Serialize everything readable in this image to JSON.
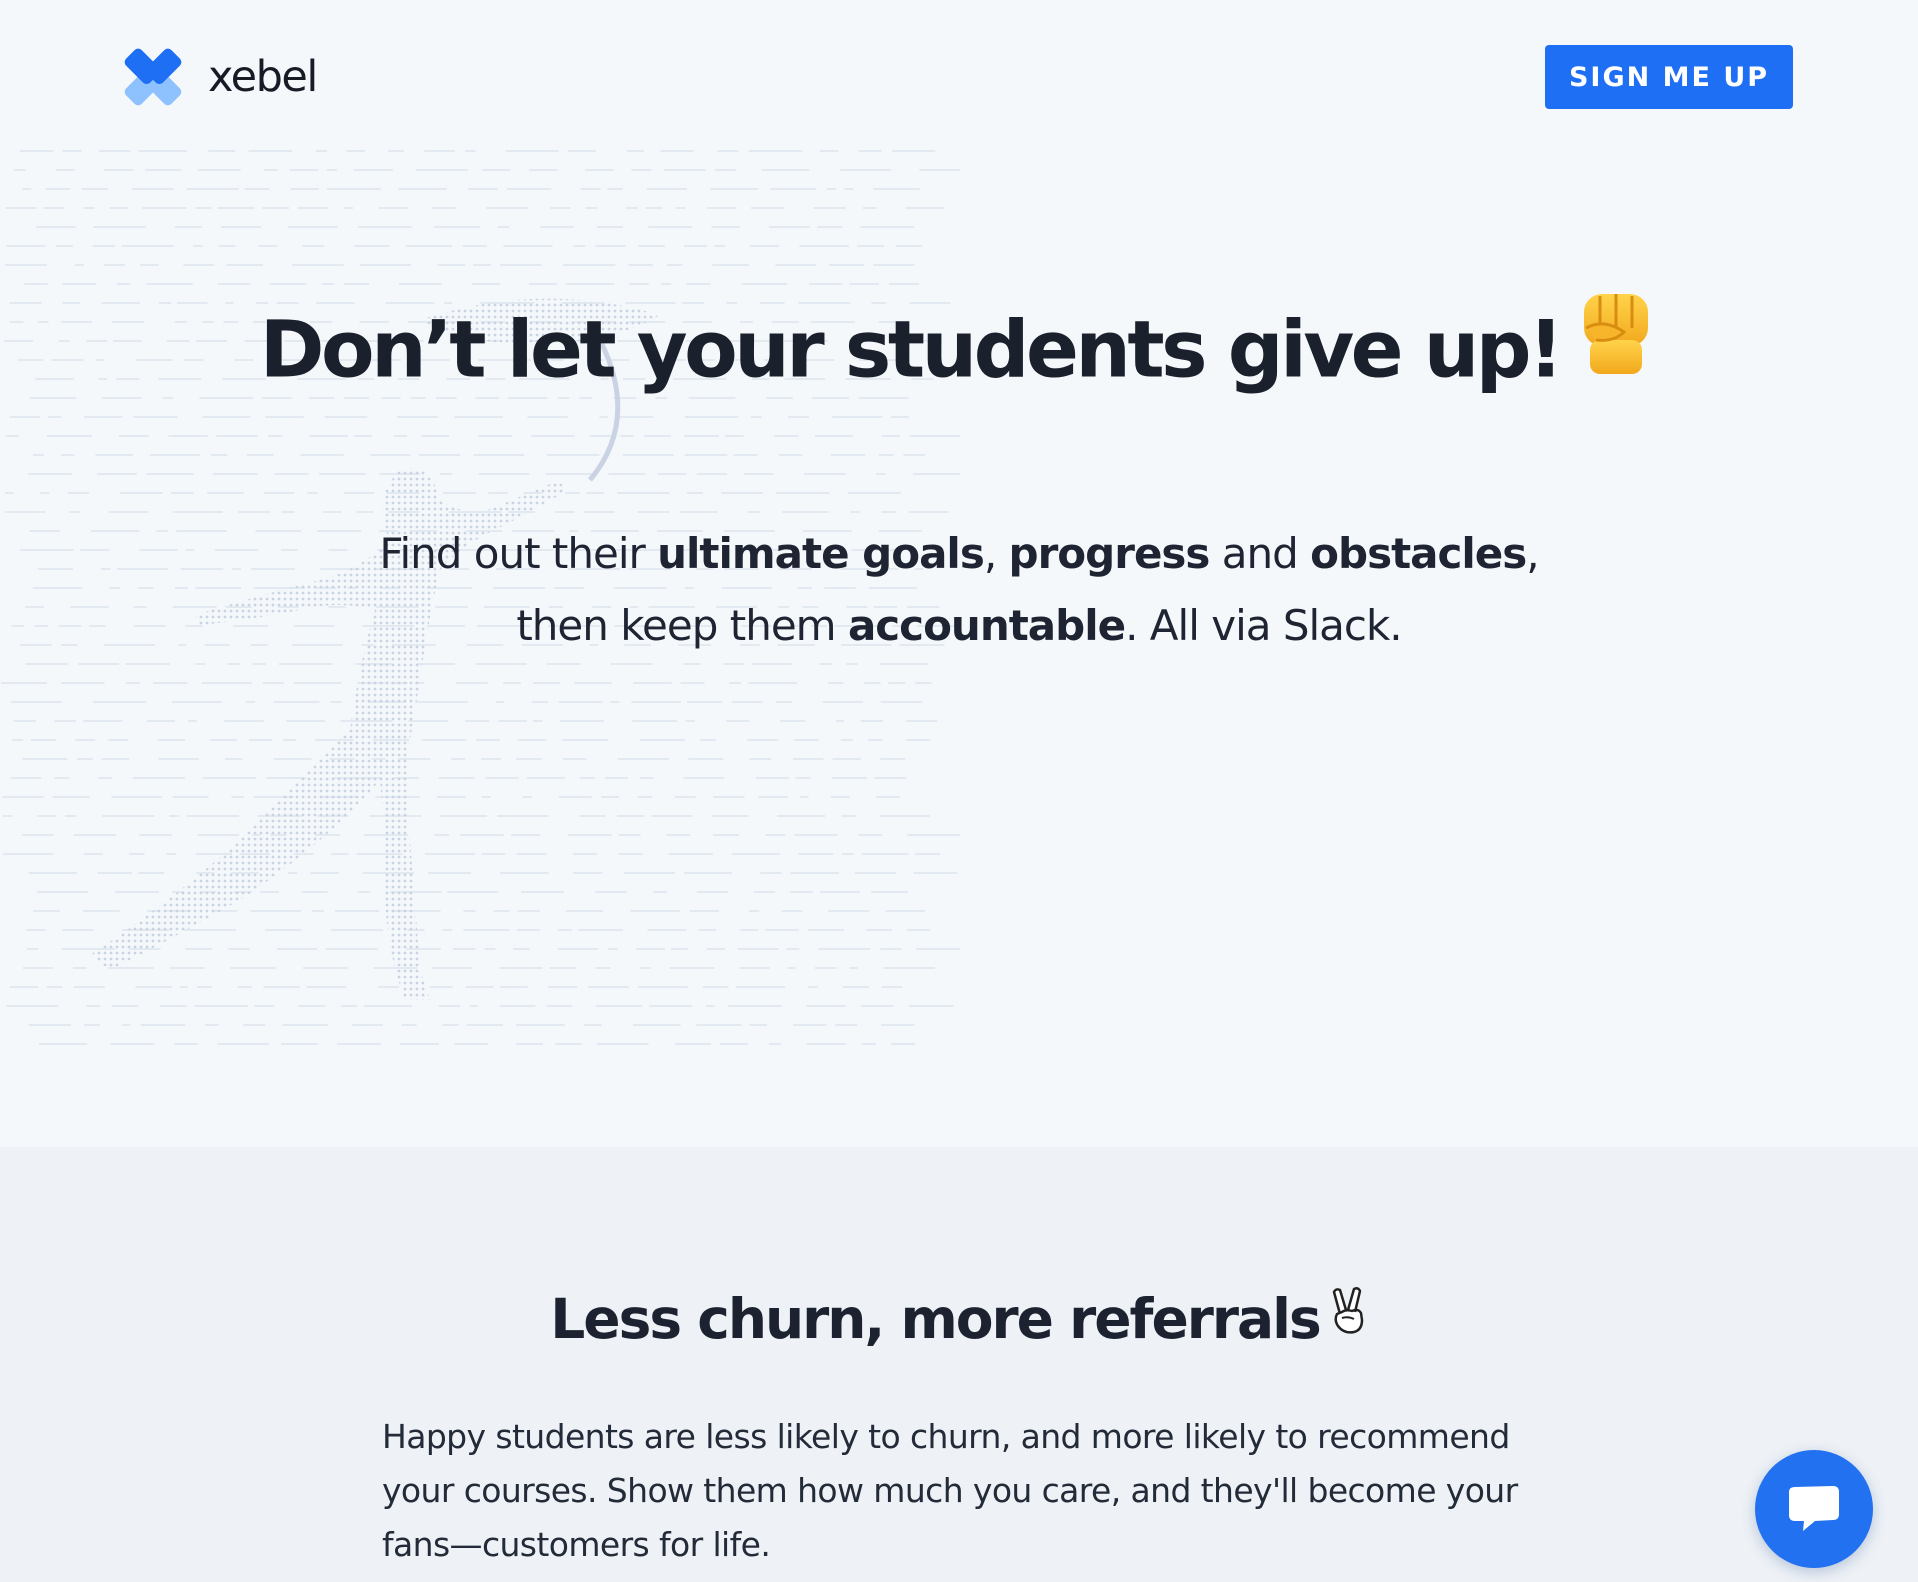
{
  "brand": {
    "name": "xebel",
    "primary_color": "#1f6ff5",
    "light_color": "#8ec2ff"
  },
  "header": {
    "cta_label": "SIGN ME UP"
  },
  "hero": {
    "headline": "Don’t let your students give up!",
    "headline_emoji": "raised-fist-emoji",
    "subhead": {
      "t1": "Find out their ",
      "b1": "ultimate goals",
      "t2": ", ",
      "b2": "progress",
      "t3": " and ",
      "b3": "obstacles",
      "t4": ",",
      "t5": "then keep them ",
      "b4": "accountable",
      "t6": ". All via Slack."
    }
  },
  "section": {
    "title": "Less churn, more referrals",
    "title_emoji": "victory-hand-emoji",
    "body": "Happy students are less likely to churn, and more likely to recommend your courses. Show them how much you care, and they'll become your fans—customers for life."
  },
  "chat": {
    "icon": "chat-icon"
  }
}
